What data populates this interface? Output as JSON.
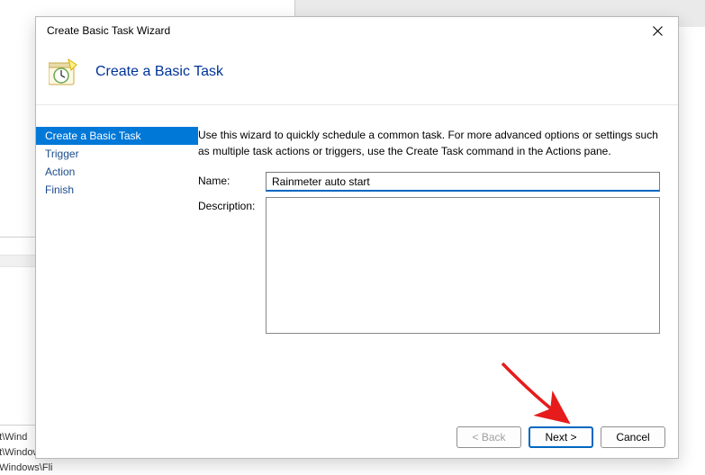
{
  "bg_texts": {
    "l1": "oft\\Wind",
    "l2": "oft\\Windows\\U...",
    "l3": "ft\\Windows\\Fli"
  },
  "dialog": {
    "title": "Create Basic Task Wizard",
    "header": "Create a Basic Task",
    "intro": "Use this wizard to quickly schedule a common task.  For more advanced options or settings such as multiple task actions or triggers, use the Create Task command in the Actions pane.",
    "steps": [
      {
        "label": "Create a Basic Task",
        "active": true
      },
      {
        "label": "Trigger",
        "active": false
      },
      {
        "label": "Action",
        "active": false
      },
      {
        "label": "Finish",
        "active": false
      }
    ],
    "fields": {
      "name_label": "Name:",
      "name_value": "Rainmeter auto start",
      "desc_label": "Description:",
      "desc_value": ""
    },
    "buttons": {
      "back": "< Back",
      "next": "Next >",
      "cancel": "Cancel"
    }
  }
}
